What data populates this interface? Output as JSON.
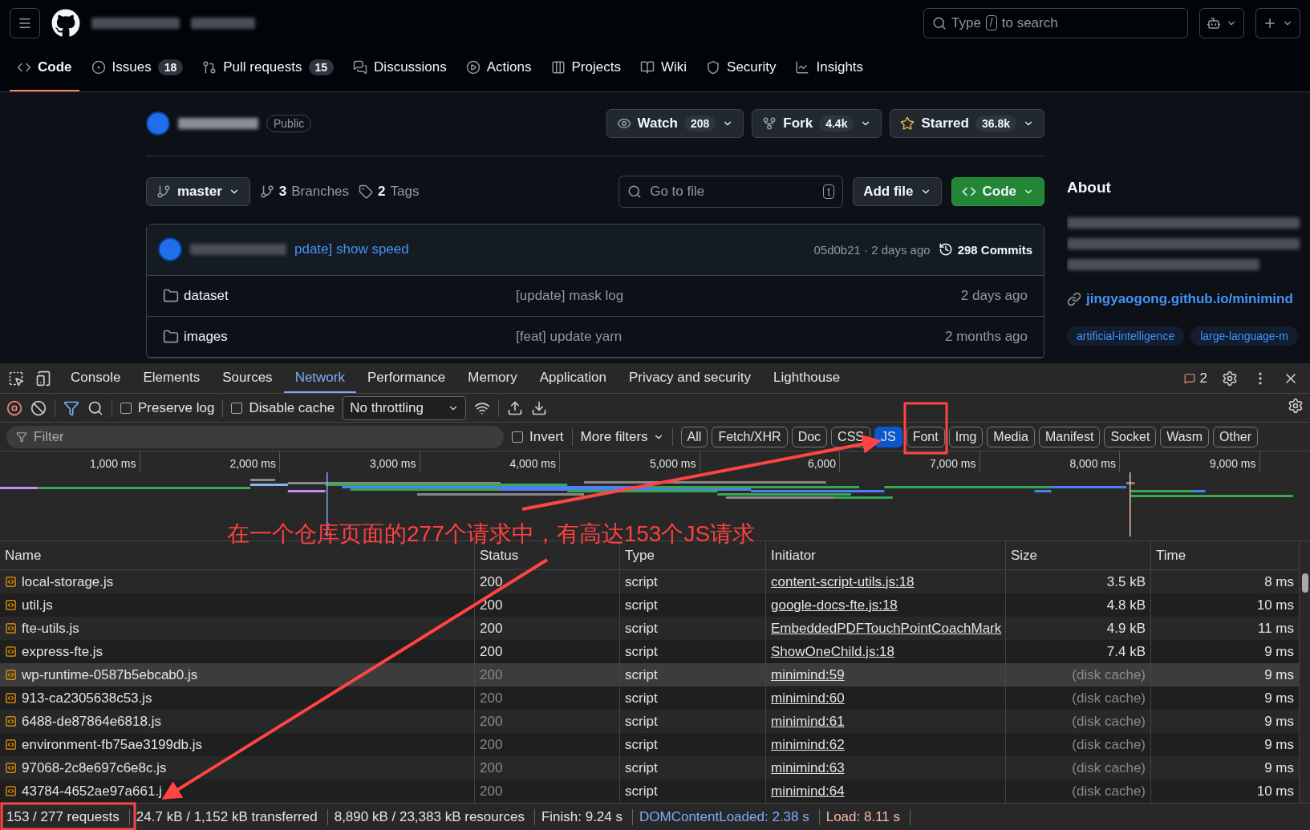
{
  "header": {
    "search": {
      "before": "Type",
      "key": "/",
      "after": "to search"
    }
  },
  "nav": [
    {
      "label": "Code",
      "selected": true
    },
    {
      "label": "Issues",
      "count": "18",
      "selected": false
    },
    {
      "label": "Pull requests",
      "count": "15",
      "selected": false
    },
    {
      "label": "Discussions",
      "selected": false
    },
    {
      "label": "Actions",
      "selected": false
    },
    {
      "label": "Projects",
      "selected": false
    },
    {
      "label": "Wiki",
      "selected": false
    },
    {
      "label": "Security",
      "selected": false
    },
    {
      "label": "Insights",
      "selected": false
    }
  ],
  "repo": {
    "visibility": "Public",
    "watch": {
      "label": "Watch",
      "count": "208"
    },
    "fork": {
      "label": "Fork",
      "count": "4.4k"
    },
    "star": {
      "label": "Starred",
      "count": "36.8k"
    },
    "branch": "master",
    "branches": {
      "count": "3",
      "label": "Branches"
    },
    "tags": {
      "count": "2",
      "label": "Tags"
    },
    "go_to_file": {
      "placeholder": "Go to file",
      "key": "t"
    },
    "add_file": "Add file",
    "code_button": "Code",
    "commit": {
      "message": "pdate] show speed",
      "hash_time": "05d0b21 · 2 days ago",
      "commits": "298 Commits"
    },
    "files": [
      {
        "name": "dataset",
        "message": "[update] mask log",
        "time": "2 days ago"
      },
      {
        "name": "images",
        "message": "[feat] update yarn",
        "time": "2 months ago"
      }
    ],
    "about": {
      "title": "About",
      "link": "jingyaogong.github.io/minimind",
      "topics": [
        "artificial-intelligence",
        "large-language-m"
      ]
    }
  },
  "devtools": {
    "tabs": [
      {
        "label": "Console",
        "selected": false
      },
      {
        "label": "Elements",
        "selected": false
      },
      {
        "label": "Sources",
        "selected": false
      },
      {
        "label": "Network",
        "selected": true
      },
      {
        "label": "Performance",
        "selected": false
      },
      {
        "label": "Memory",
        "selected": false
      },
      {
        "label": "Application",
        "selected": false
      },
      {
        "label": "Privacy and security",
        "selected": false
      },
      {
        "label": "Lighthouse",
        "selected": false
      }
    ],
    "issues": "2",
    "toolbar": {
      "preserve_log": {
        "label": "Preserve log",
        "checked": false
      },
      "disable_cache": {
        "label": "Disable cache",
        "checked": false
      },
      "throttling": "No throttling"
    },
    "filter": {
      "placeholder": "Filter",
      "invert": {
        "label": "Invert",
        "checked": false
      },
      "more_filters": "More filters",
      "types": [
        {
          "label": "All",
          "selected": false
        },
        {
          "label": "Fetch/XHR",
          "selected": false
        },
        {
          "label": "Doc",
          "selected": false
        },
        {
          "label": "CSS",
          "selected": false
        },
        {
          "label": "JS",
          "selected": true
        },
        {
          "label": "Font",
          "selected": false
        },
        {
          "label": "Img",
          "selected": false
        },
        {
          "label": "Media",
          "selected": false
        },
        {
          "label": "Manifest",
          "selected": false
        },
        {
          "label": "Socket",
          "selected": false
        },
        {
          "label": "Wasm",
          "selected": false
        },
        {
          "label": "Other",
          "selected": false
        }
      ]
    },
    "timeline": {
      "ticks": [
        "1,000 ms",
        "2,000 ms",
        "3,000 ms",
        "4,000 ms",
        "5,000 ms",
        "6,000",
        "7,000 ms",
        "8,000 ms",
        "9,000 ms"
      ]
    },
    "columns": [
      "Name",
      "Status",
      "Type",
      "Initiator",
      "Size",
      "Time"
    ],
    "rows": [
      {
        "name": "local-storage.js",
        "status": "200",
        "type": "script",
        "initiator": "content-script-utils.js:18",
        "size": "3.5 kB",
        "time": "8 ms",
        "cached": false,
        "highlighted": false
      },
      {
        "name": "util.js",
        "status": "200",
        "type": "script",
        "initiator": "google-docs-fte.js:18",
        "size": "4.8 kB",
        "time": "10 ms",
        "cached": false,
        "highlighted": false
      },
      {
        "name": "fte-utils.js",
        "status": "200",
        "type": "script",
        "initiator": "EmbeddedPDFTouchPointCoachMark",
        "size": "4.9 kB",
        "time": "11 ms",
        "cached": false,
        "highlighted": false
      },
      {
        "name": "express-fte.js",
        "status": "200",
        "type": "script",
        "initiator": "ShowOneChild.js:18",
        "size": "7.4 kB",
        "time": "9 ms",
        "cached": false,
        "highlighted": false
      },
      {
        "name": "wp-runtime-0587b5ebcab0.js",
        "status": "200",
        "type": "script",
        "initiator": "minimind:59",
        "size": "(disk cache)",
        "time": "9 ms",
        "cached": true,
        "highlighted": true
      },
      {
        "name": "913-ca2305638c53.js",
        "status": "200",
        "type": "script",
        "initiator": "minimind:60",
        "size": "(disk cache)",
        "time": "9 ms",
        "cached": true,
        "highlighted": false
      },
      {
        "name": "6488-de87864e6818.js",
        "status": "200",
        "type": "script",
        "initiator": "minimind:61",
        "size": "(disk cache)",
        "time": "9 ms",
        "cached": true,
        "highlighted": false
      },
      {
        "name": "environment-fb75ae3199db.js",
        "status": "200",
        "type": "script",
        "initiator": "minimind:62",
        "size": "(disk cache)",
        "time": "9 ms",
        "cached": true,
        "highlighted": false
      },
      {
        "name": "97068-2c8e697c6e8c.js",
        "status": "200",
        "type": "script",
        "initiator": "minimind:63",
        "size": "(disk cache)",
        "time": "9 ms",
        "cached": true,
        "highlighted": false
      },
      {
        "name": "43784-4652ae97a661.j",
        "status": "200",
        "type": "script",
        "initiator": "minimind:64",
        "size": "(disk cache)",
        "time": "10 ms",
        "cached": true,
        "highlighted": false
      }
    ],
    "status_bar": [
      {
        "text": "153 / 277 requests",
        "kind": "plain"
      },
      {
        "text": "24.7 kB / 1,152 kB transferred",
        "kind": "plain"
      },
      {
        "text": "8,890 kB / 23,383 kB resources",
        "kind": "plain"
      },
      {
        "text": "Finish: 9.24 s",
        "kind": "plain"
      },
      {
        "text": "DOMContentLoaded: 2.38 s",
        "kind": "dcl"
      },
      {
        "text": "Load: 8.11 s",
        "kind": "load"
      }
    ]
  },
  "annotation": {
    "text": "在一个仓库页面的277个请求中，有高达153个JS请求"
  }
}
